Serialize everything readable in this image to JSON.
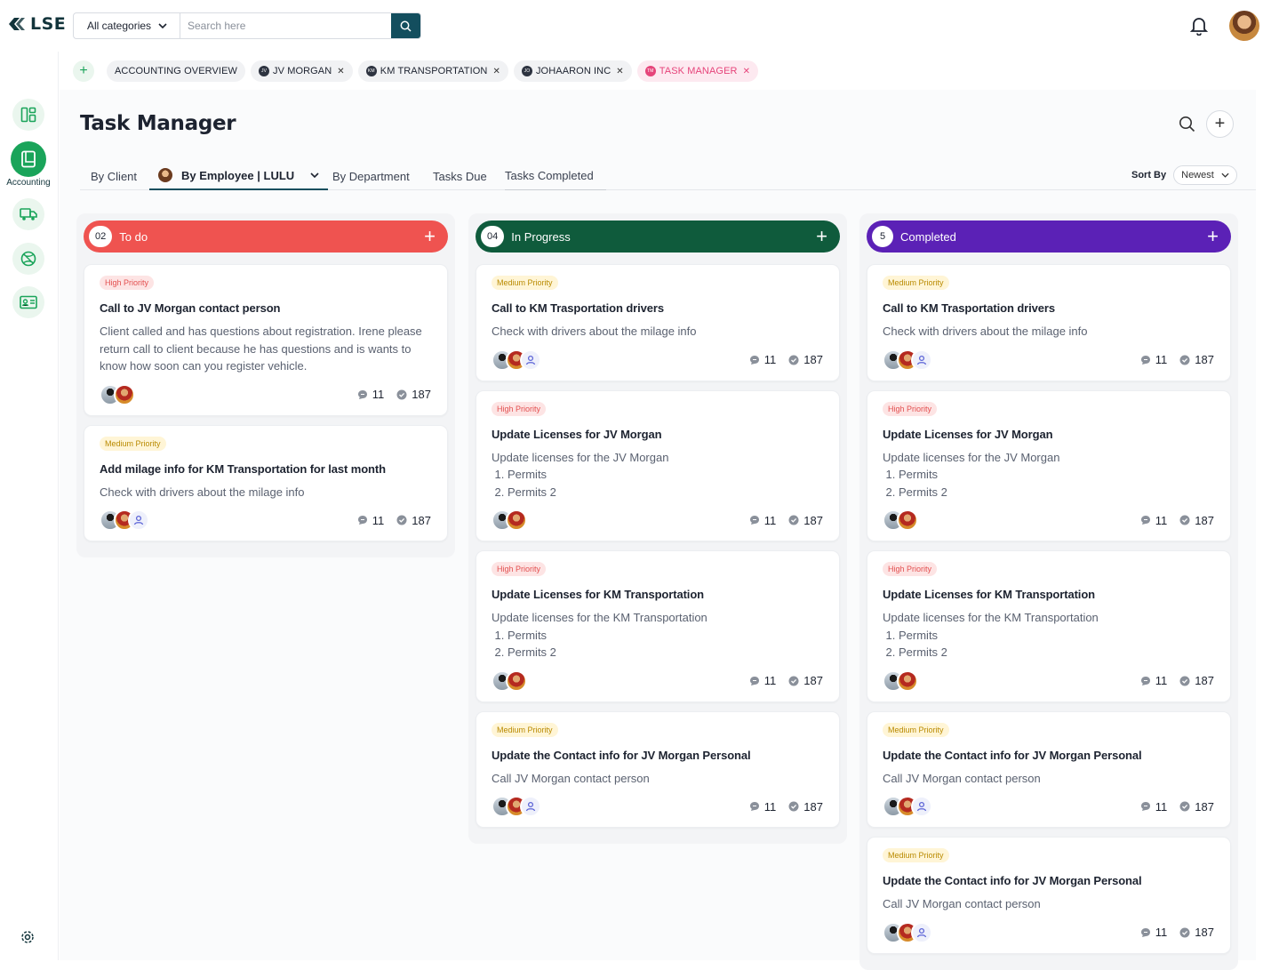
{
  "brand": {
    "logo_text": "LSE"
  },
  "search": {
    "category": "All categories",
    "placeholder": "Search here"
  },
  "sidebar": {
    "active_label": "Accounting"
  },
  "tabs": [
    {
      "label": "ACCOUNTING OVERVIEW",
      "icon": ""
    },
    {
      "label": "JV MORGAN",
      "icon": "JV"
    },
    {
      "label": "KM TRANSPORTATION",
      "icon": "KM"
    },
    {
      "label": "JOHAARON INC",
      "icon": "JO"
    },
    {
      "label": "TASK MANAGER",
      "icon": "TM"
    }
  ],
  "page": {
    "title": "Task Manager"
  },
  "views": {
    "by_client": "By Client",
    "by_employee": "By Employee | LULU",
    "by_department": "By Department",
    "tasks_due": "Tasks Due",
    "tasks_completed": "Tasks Completed"
  },
  "sort": {
    "label": "Sort By",
    "value": "Newest"
  },
  "colors": {
    "todo": "#ef5350",
    "inprogress": "#0f5b3c",
    "completed": "#5b21b6",
    "accent": "#134e5e",
    "green": "#1aa45a"
  },
  "columns": [
    {
      "count": "02",
      "title": "To do",
      "cards": [
        {
          "priority": "High Priority",
          "title": "Call to JV Morgan contact person",
          "desc": "Client called and has questions about registration. Irene please return call to client because he has questions and is wants to know how soon can you register vehicle.",
          "comments": "11",
          "checks": "187"
        },
        {
          "priority": "Medium Priority",
          "title": "Add milage info for KM Transportation for last month",
          "desc": "Check with drivers about the milage info",
          "comments": "11",
          "checks": "187"
        }
      ]
    },
    {
      "count": "04",
      "title": "In Progress",
      "cards": [
        {
          "priority": "Medium Priority",
          "title": "Call to KM Trasportation drivers",
          "desc": "Check with drivers about the milage info",
          "comments": "11",
          "checks": "187"
        },
        {
          "priority": "High Priority",
          "title": "Update Licenses for JV Morgan",
          "desc": "Update licenses for the JV Morgan",
          "list": [
            "Permits",
            "Permits 2"
          ],
          "comments": "11",
          "checks": "187"
        },
        {
          "priority": "High Priority",
          "title": "Update Licenses for KM Transportation",
          "desc": "Update licenses for the KM Transportation",
          "list": [
            "Permits",
            "Permits 2"
          ],
          "comments": "11",
          "checks": "187"
        },
        {
          "priority": "Medium Priority",
          "title": "Update the Contact info for JV Morgan Personal",
          "desc": "Call JV Morgan contact person",
          "comments": "11",
          "checks": "187"
        }
      ]
    },
    {
      "count": "5",
      "title": "Completed",
      "cards": [
        {
          "priority": "Medium Priority",
          "title": "Call to KM Trasportation drivers",
          "desc": "Check with drivers about the milage info",
          "comments": "11",
          "checks": "187"
        },
        {
          "priority": "High Priority",
          "title": "Update Licenses for JV Morgan",
          "desc": "Update licenses for the JV Morgan",
          "list": [
            "Permits",
            "Permits 2"
          ],
          "comments": "11",
          "checks": "187"
        },
        {
          "priority": "High Priority",
          "title": "Update Licenses for KM Transportation",
          "desc": "Update licenses for the KM Transportation",
          "list": [
            "Permits",
            "Permits 2"
          ],
          "comments": "11",
          "checks": "187"
        },
        {
          "priority": "Medium Priority",
          "title": "Update the Contact info for JV Morgan Personal",
          "desc": "Call JV Morgan contact person",
          "comments": "11",
          "checks": "187"
        },
        {
          "priority": "Medium Priority",
          "title": "Update the Contact info for JV Morgan Personal",
          "desc": "Call JV Morgan contact person",
          "comments": "11",
          "checks": "187"
        }
      ]
    }
  ]
}
